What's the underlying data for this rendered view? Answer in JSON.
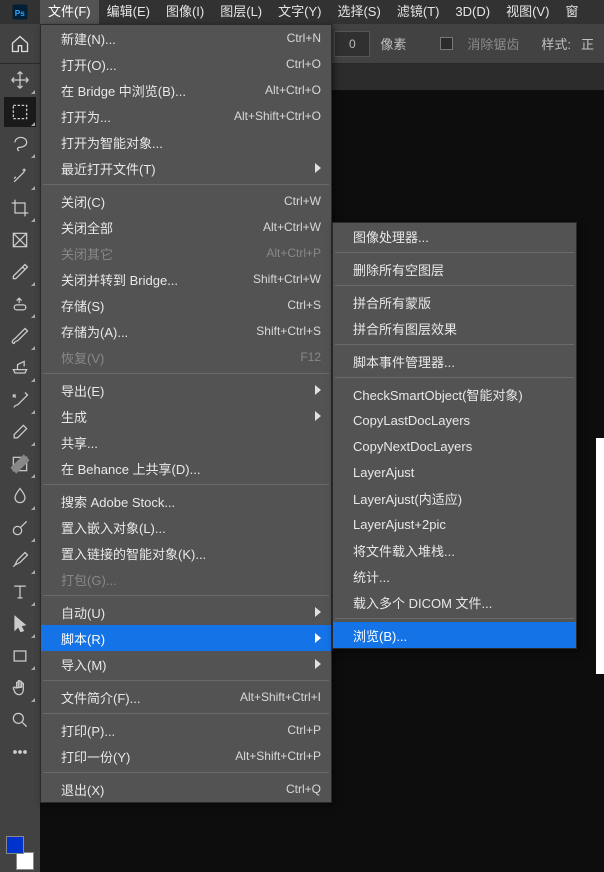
{
  "menubar": {
    "items": [
      {
        "label": "文件(F)"
      },
      {
        "label": "编辑(E)"
      },
      {
        "label": "图像(I)"
      },
      {
        "label": "图层(L)"
      },
      {
        "label": "文字(Y)"
      },
      {
        "label": "选择(S)"
      },
      {
        "label": "滤镜(T)"
      },
      {
        "label": "3D(D)"
      },
      {
        "label": "视图(V)"
      },
      {
        "label": "窗"
      }
    ],
    "active_index": 0
  },
  "options": {
    "pixel_value": "0",
    "pixel_unit": "像素",
    "antialias_label": "消除锯齿",
    "style_label": "样式:",
    "style_value": "正"
  },
  "file_menu": [
    {
      "label": "新建(N)...",
      "shortcut": "Ctrl+N"
    },
    {
      "label": "打开(O)...",
      "shortcut": "Ctrl+O"
    },
    {
      "label": "在 Bridge 中浏览(B)...",
      "shortcut": "Alt+Ctrl+O"
    },
    {
      "label": "打开为...",
      "shortcut": "Alt+Shift+Ctrl+O"
    },
    {
      "label": "打开为智能对象..."
    },
    {
      "label": "最近打开文件(T)",
      "sub": true
    },
    {
      "sep": true
    },
    {
      "label": "关闭(C)",
      "shortcut": "Ctrl+W"
    },
    {
      "label": "关闭全部",
      "shortcut": "Alt+Ctrl+W"
    },
    {
      "label": "关闭其它",
      "shortcut": "Alt+Ctrl+P",
      "disabled": true
    },
    {
      "label": "关闭并转到 Bridge...",
      "shortcut": "Shift+Ctrl+W"
    },
    {
      "label": "存储(S)",
      "shortcut": "Ctrl+S"
    },
    {
      "label": "存储为(A)...",
      "shortcut": "Shift+Ctrl+S"
    },
    {
      "label": "恢复(V)",
      "shortcut": "F12",
      "disabled": true
    },
    {
      "sep": true
    },
    {
      "label": "导出(E)",
      "sub": true
    },
    {
      "label": "生成",
      "sub": true
    },
    {
      "label": "共享..."
    },
    {
      "label": "在 Behance 上共享(D)..."
    },
    {
      "sep": true
    },
    {
      "label": "搜索 Adobe Stock..."
    },
    {
      "label": "置入嵌入对象(L)..."
    },
    {
      "label": "置入链接的智能对象(K)..."
    },
    {
      "label": "打包(G)...",
      "disabled": true
    },
    {
      "sep": true
    },
    {
      "label": "自动(U)",
      "sub": true
    },
    {
      "label": "脚本(R)",
      "sub": true,
      "hover": true
    },
    {
      "label": "导入(M)",
      "sub": true
    },
    {
      "sep": true
    },
    {
      "label": "文件简介(F)...",
      "shortcut": "Alt+Shift+Ctrl+I"
    },
    {
      "sep": true
    },
    {
      "label": "打印(P)...",
      "shortcut": "Ctrl+P"
    },
    {
      "label": "打印一份(Y)",
      "shortcut": "Alt+Shift+Ctrl+P"
    },
    {
      "sep": true
    },
    {
      "label": "退出(X)",
      "shortcut": "Ctrl+Q"
    }
  ],
  "script_menu": [
    {
      "label": "图像处理器..."
    },
    {
      "sep": true
    },
    {
      "label": "删除所有空图层"
    },
    {
      "sep": true
    },
    {
      "label": "拼合所有蒙版"
    },
    {
      "label": "拼合所有图层效果"
    },
    {
      "sep": true
    },
    {
      "label": "脚本事件管理器..."
    },
    {
      "sep": true
    },
    {
      "label": "CheckSmartObject(智能对象)"
    },
    {
      "label": "CopyLastDocLayers"
    },
    {
      "label": "CopyNextDocLayers"
    },
    {
      "label": "LayerAjust"
    },
    {
      "label": "LayerAjust(内适应)"
    },
    {
      "label": "LayerAjust+2pic"
    },
    {
      "label": "将文件载入堆栈..."
    },
    {
      "label": "统计..."
    },
    {
      "label": "载入多个 DICOM 文件..."
    },
    {
      "sep": true
    },
    {
      "label": "浏览(B)...",
      "hover": true
    }
  ],
  "tools_list": [
    "move",
    "marquee",
    "lasso",
    "magic-wand",
    "crop",
    "frame",
    "eyedropper",
    "spot-heal",
    "brush",
    "clone-stamp",
    "history-brush",
    "eraser",
    "gradient",
    "blur",
    "dodge",
    "pen",
    "type",
    "path-select",
    "rectangle",
    "hand",
    "zoom",
    "edit-toolbar",
    "more"
  ],
  "colors": {
    "fg": "#0033cc",
    "bg": "#ffffff"
  }
}
